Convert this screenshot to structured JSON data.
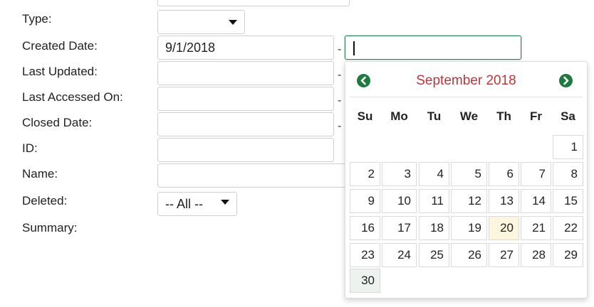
{
  "form": {
    "type_label": "Type:",
    "created_label": "Created Date:",
    "updated_label": "Last Updated:",
    "accessed_label": "Last Accessed On:",
    "closed_label": "Closed Date:",
    "id_label": "ID:",
    "name_label": "Name:",
    "deleted_label": "Deleted:",
    "summary_label": "Summary:",
    "created_from_value": "9/1/2018",
    "deleted_value": "-- All --",
    "range_separator": "-"
  },
  "calendar": {
    "title": "September 2018",
    "prev_icon": "chevron-left-circle-icon",
    "next_icon": "chevron-right-circle-icon",
    "weekdays": [
      "Su",
      "Mo",
      "Tu",
      "We",
      "Th",
      "Fr",
      "Sa"
    ],
    "weeks": [
      [
        "",
        "",
        "",
        "",
        "",
        "",
        "1"
      ],
      [
        "2",
        "3",
        "4",
        "5",
        "6",
        "7",
        "8"
      ],
      [
        "9",
        "10",
        "11",
        "12",
        "13",
        "14",
        "15"
      ],
      [
        "16",
        "17",
        "18",
        "19",
        "20",
        "21",
        "22"
      ],
      [
        "23",
        "24",
        "25",
        "26",
        "27",
        "28",
        "29"
      ],
      [
        "30",
        "",
        "",
        "",
        "",
        "",
        ""
      ]
    ],
    "today": "20",
    "hovered": "30",
    "colors": {
      "title": "#c0353b",
      "nav": "#1e7a3e",
      "today_bg": "#fdf6df",
      "focus_border": "#2e8b57"
    }
  }
}
